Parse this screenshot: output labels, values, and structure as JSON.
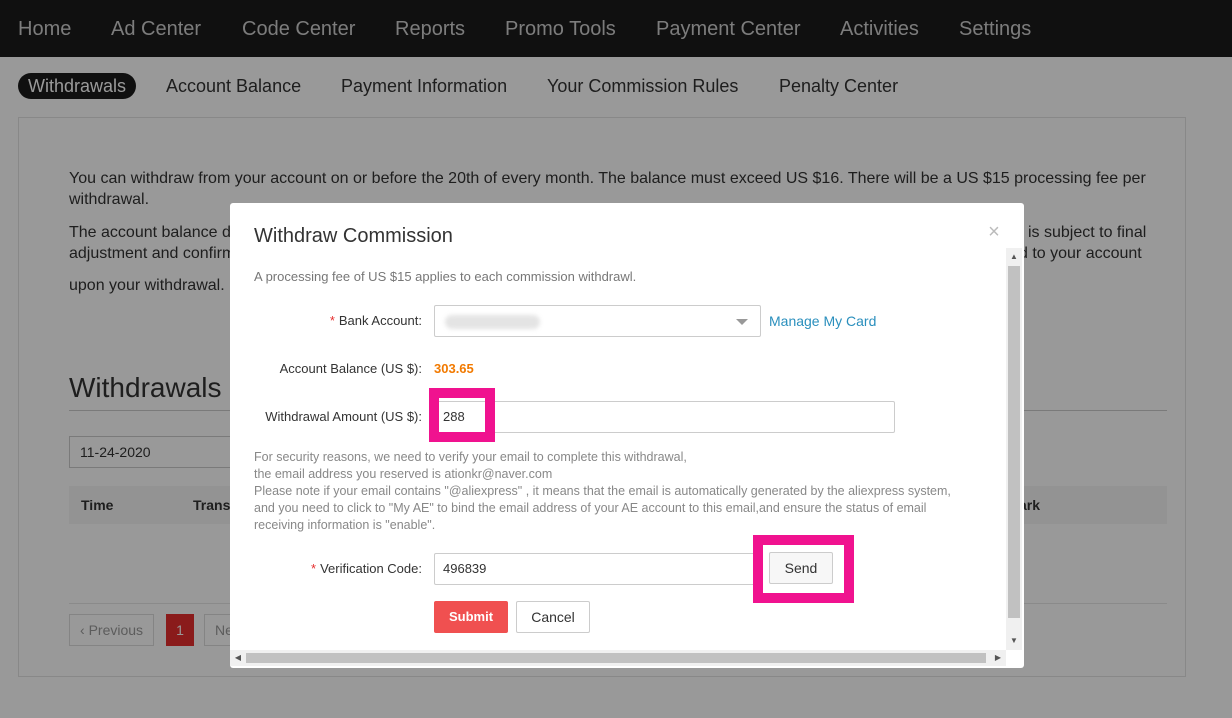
{
  "top_nav": [
    "Home",
    "Ad Center",
    "Code Center",
    "Reports",
    "Promo Tools",
    "Payment Center",
    "Activities",
    "Settings"
  ],
  "sub_nav": [
    "Withdrawals",
    "Account Balance",
    "Payment Information",
    "Your Commission Rules",
    "Penalty Center"
  ],
  "background": {
    "notice_line1": "You can withdraw from your account on or before the 20th of every month. The balance must exceed US $16. There will be a US $15 processing fee per",
    "notice_line2": "withdrawal.",
    "notice_line3_left": "The account balance d",
    "notice_line3_right": "is subject to final",
    "notice_line4_left": "adjustment and confirm",
    "notice_line4_right": "d to your account",
    "notice_line5": "upon your withdrawal.",
    "section_title": "Withdrawals",
    "date_value": "11-24-2020",
    "col_time": "Time",
    "col_trans": "Transf",
    "col_remark": "ark",
    "prev_label": "Previous",
    "page_current": "1",
    "next_label": "Ne"
  },
  "modal": {
    "title": "Withdraw Commission",
    "close": "×",
    "fee_note": "A processing fee of US $15 applies to each commission withdrawl.",
    "bank_label": "Bank Account:",
    "manage_link": "Manage My Card",
    "balance_label": "Account Balance (US $):",
    "balance_value": "303.65",
    "amount_label": "Withdrawal Amount (US $):",
    "amount_value": "288",
    "security_lines": [
      "For security reasons, we need to verify your email to complete this withdrawal,",
      "the email address you reserved is ationkr@naver.com",
      "Please note if your email contains \"@aliexpress\" , it means that the email is automatically generated by the aliexpress system,",
      "and you need to click to \"My AE\" to bind the email address of your AE account to this email,and ensure the status of email",
      "receiving information is \"enable\"."
    ],
    "code_label": "Verification Code:",
    "code_value": "496839",
    "send_label": "Send",
    "submit_label": "Submit",
    "cancel_label": "Cancel",
    "required_mark": "*"
  },
  "colors": {
    "accent": "#f05050",
    "balance": "#f27a00",
    "link": "#2a8fbd",
    "highlight": "#f0128f",
    "nav_bg": "#1b1b1b"
  }
}
